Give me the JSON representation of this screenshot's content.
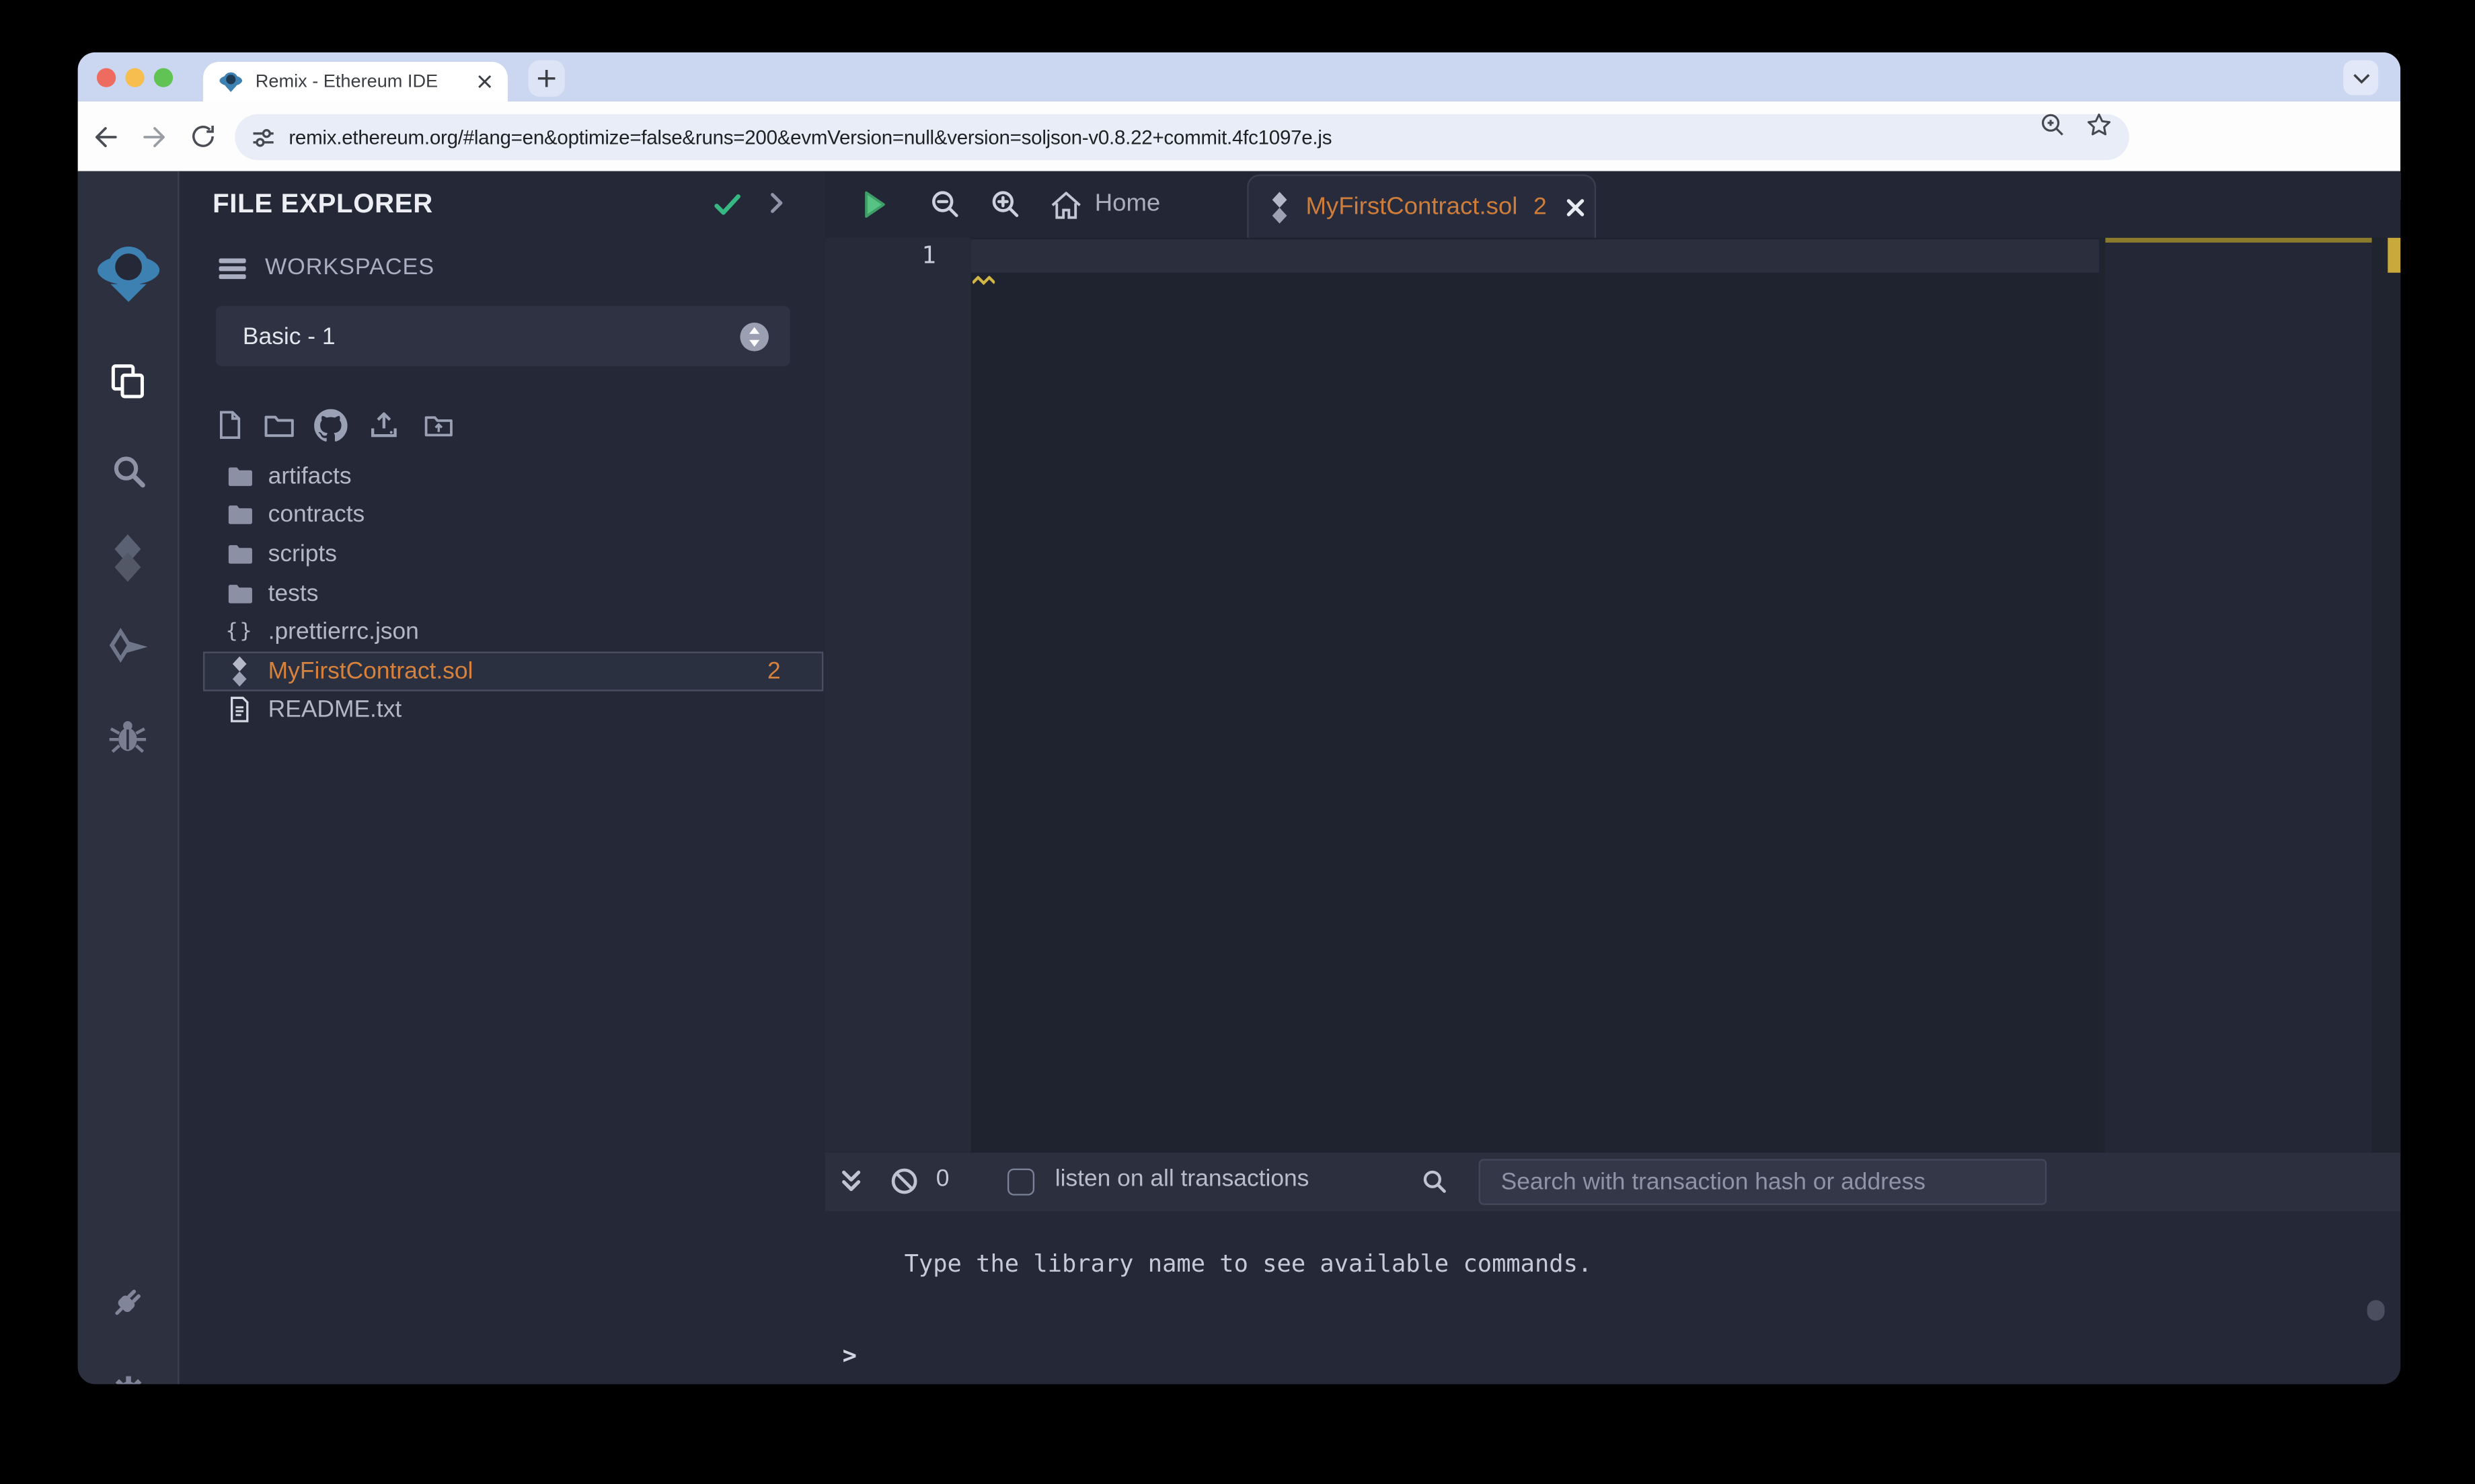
{
  "browser": {
    "tab_title": "Remix - Ethereum IDE",
    "url": "remix.ethereum.org/#lang=en&optimize=false&runs=200&evmVersion=null&version=soljson-v0.8.22+commit.4fc1097e.js"
  },
  "file_explorer": {
    "title": "FILE EXPLORER",
    "workspaces_label": "WORKSPACES",
    "workspace_selected": "Basic - 1",
    "files": [
      {
        "name": "artifacts",
        "type": "folder"
      },
      {
        "name": "contracts",
        "type": "folder"
      },
      {
        "name": "scripts",
        "type": "folder"
      },
      {
        "name": "tests",
        "type": "folder"
      },
      {
        "name": ".prettierrc.json",
        "type": "json"
      },
      {
        "name": "MyFirstContract.sol",
        "type": "solidity",
        "badge": "2",
        "selected": true
      },
      {
        "name": "README.txt",
        "type": "text"
      }
    ]
  },
  "editor": {
    "home_tab_label": "Home",
    "active_tab_label": "MyFirstContract.sol",
    "active_tab_badge": "2",
    "line_number": "1"
  },
  "terminal": {
    "pending_count": "0",
    "listen_label": "listen on all transactions",
    "search_placeholder": "Search with transaction hash or address",
    "message": "Type the library name to see available commands.",
    "prompt": ">"
  },
  "colors": {
    "accent_orange": "#d6823c",
    "remix_blue": "#3d80b2",
    "success_green": "#36b882",
    "play_green": "#57c383",
    "warning_gold": "#c9a93c",
    "panel_bg": "#242837",
    "editor_bg": "#1f2330"
  }
}
